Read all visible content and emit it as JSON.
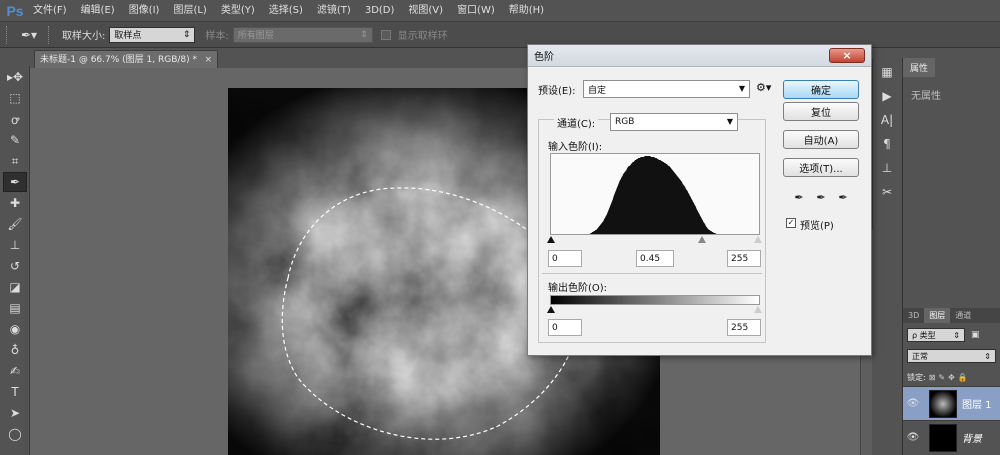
{
  "app": {
    "logo": "Ps"
  },
  "menu": [
    "文件(F)",
    "编辑(E)",
    "图像(I)",
    "图层(L)",
    "类型(Y)",
    "选择(S)",
    "滤镜(T)",
    "3D(D)",
    "视图(V)",
    "窗口(W)",
    "帮助(H)"
  ],
  "options": {
    "sample_size_label": "取样大小:",
    "sample_size_value": "取样点",
    "sample_label": "样本:",
    "sample_value": "所有图层",
    "show_ring_label": "显示取样环"
  },
  "document": {
    "tab_title": "未标题-1 @ 66.7% (图层 1, RGB/8) *",
    "close": "×"
  },
  "dialog": {
    "title": "色阶",
    "close": "×",
    "preset_label": "预设(E):",
    "preset_value": "自定",
    "channel_label": "通道(C):",
    "channel_value": "RGB",
    "input_levels_label": "输入色阶(I):",
    "input_black": "0",
    "input_gamma": "0.45",
    "input_white": "255",
    "output_levels_label": "输出色阶(O):",
    "output_black": "0",
    "output_white": "255",
    "buttons": {
      "ok": "确定",
      "reset": "复位",
      "auto": "自动(A)",
      "options": "选项(T)..."
    },
    "preview_label": "预览(P)",
    "preview_checked": true,
    "histogram": [
      0,
      0,
      0,
      0,
      0,
      0,
      0,
      0,
      0,
      0,
      0,
      0,
      0,
      0,
      0,
      0,
      0,
      0,
      0,
      0,
      0,
      0,
      0,
      0,
      0,
      0,
      0,
      0,
      0,
      0,
      0,
      0,
      0,
      0,
      0,
      0,
      0,
      0,
      0,
      0,
      0,
      0,
      0,
      0,
      0,
      0,
      0,
      0,
      0,
      0,
      1,
      1,
      2,
      2,
      3,
      3,
      4,
      4,
      5,
      6,
      7,
      8,
      9,
      10,
      11,
      12,
      13,
      15,
      16,
      18,
      19,
      21,
      23,
      25,
      27,
      29,
      31,
      33,
      35,
      38,
      40,
      42,
      44,
      46,
      48,
      50,
      52,
      54,
      55,
      57,
      58,
      60,
      61,
      62,
      63,
      64,
      66,
      67,
      68,
      68,
      69,
      70,
      71,
      72,
      72,
      73,
      74,
      74,
      75,
      75,
      76,
      76,
      76,
      77,
      77,
      77,
      77,
      77,
      78,
      78,
      78,
      78,
      78,
      78,
      78,
      78,
      77,
      77,
      77,
      77,
      77,
      76,
      76,
      76,
      75,
      75,
      74,
      74,
      74,
      73,
      73,
      72,
      72,
      71,
      71,
      70,
      70,
      69,
      68,
      68,
      67,
      66,
      65,
      64,
      63,
      62,
      61,
      60,
      59,
      58,
      57,
      56,
      55,
      54,
      53,
      52,
      50,
      49,
      48,
      47,
      45,
      44,
      43,
      41,
      40,
      38,
      37,
      35,
      34,
      32,
      31,
      29,
      28,
      26,
      24,
      23,
      21,
      20,
      18,
      17,
      15,
      14,
      12,
      11,
      10,
      8,
      7,
      6,
      5,
      4,
      4,
      3,
      3,
      2,
      2,
      1,
      1,
      1,
      0,
      0,
      0,
      0,
      0,
      0,
      0,
      0,
      0,
      0,
      0,
      0,
      0,
      0,
      0,
      0,
      0,
      0,
      0,
      0,
      0,
      0,
      0,
      0,
      0,
      0,
      0,
      0,
      0,
      0,
      0,
      0,
      0,
      0,
      0,
      0,
      0,
      0,
      0,
      0,
      0,
      0,
      0,
      0,
      0,
      0,
      0,
      0,
      0,
      0,
      0,
      0,
      0,
      0,
      0
    ]
  },
  "properties": {
    "tab": "属性",
    "body": "无属性"
  },
  "layers": {
    "tabs": [
      "3D",
      "图层",
      "通道"
    ],
    "active_tab": "图层",
    "filter_label": "ρ 类型",
    "blend_mode": "正常",
    "lock_label": "锁定:",
    "items": [
      {
        "name": "图层 1",
        "selected": true
      },
      {
        "name": "背景",
        "selected": false
      }
    ]
  },
  "colors": {
    "accent": "#4f8fd6",
    "selected_layer": "#8a9fc6",
    "dialog_primary": "#3c7fb1"
  }
}
